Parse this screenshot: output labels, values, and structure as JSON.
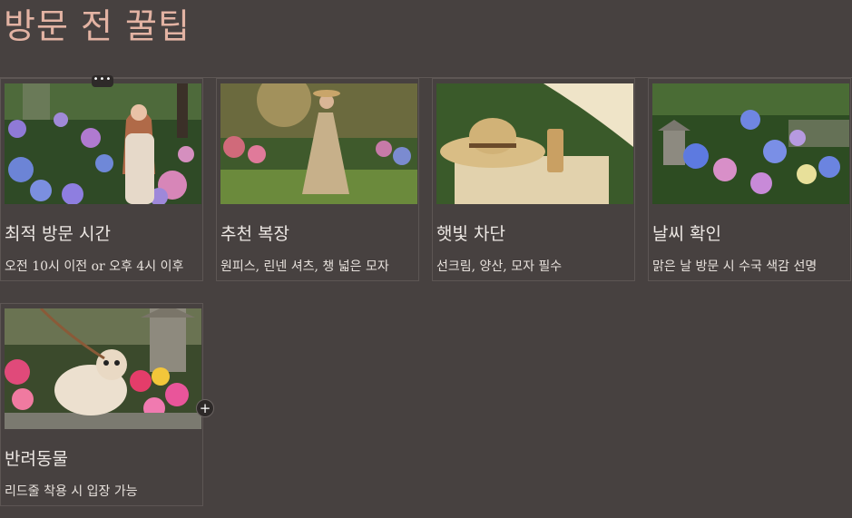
{
  "page": {
    "title": "방문 전 꿀팁"
  },
  "cards": [
    {
      "title": "최적 방문 시간",
      "description": "오전 10시 이전 or 오후 4시 이후",
      "image": "woman-among-hydrangeas-photo"
    },
    {
      "title": "추천 복장",
      "description": "원피스, 린넨 셔츠, 챙 넓은 모자",
      "image": "woman-in-linen-dress-garden-photo"
    },
    {
      "title": "햇빛 차단",
      "description": "선크림, 양산, 모자 필수",
      "image": "straw-hat-sunscreen-parasol-photo"
    },
    {
      "title": "날씨 확인",
      "description": "맑은 날 방문 시 수국 색감 선명",
      "image": "hydrangea-garden-stone-lantern-photo"
    },
    {
      "title": "반려동물",
      "description": "리드줄 착용 시 입장 가능",
      "image": "small-dog-in-flower-garden-photo"
    }
  ],
  "controls": {
    "more_label": "•••",
    "add_label": "+"
  },
  "colors": {
    "background": "#474140",
    "title": "#e3b3a3",
    "border": "#5d5654"
  }
}
